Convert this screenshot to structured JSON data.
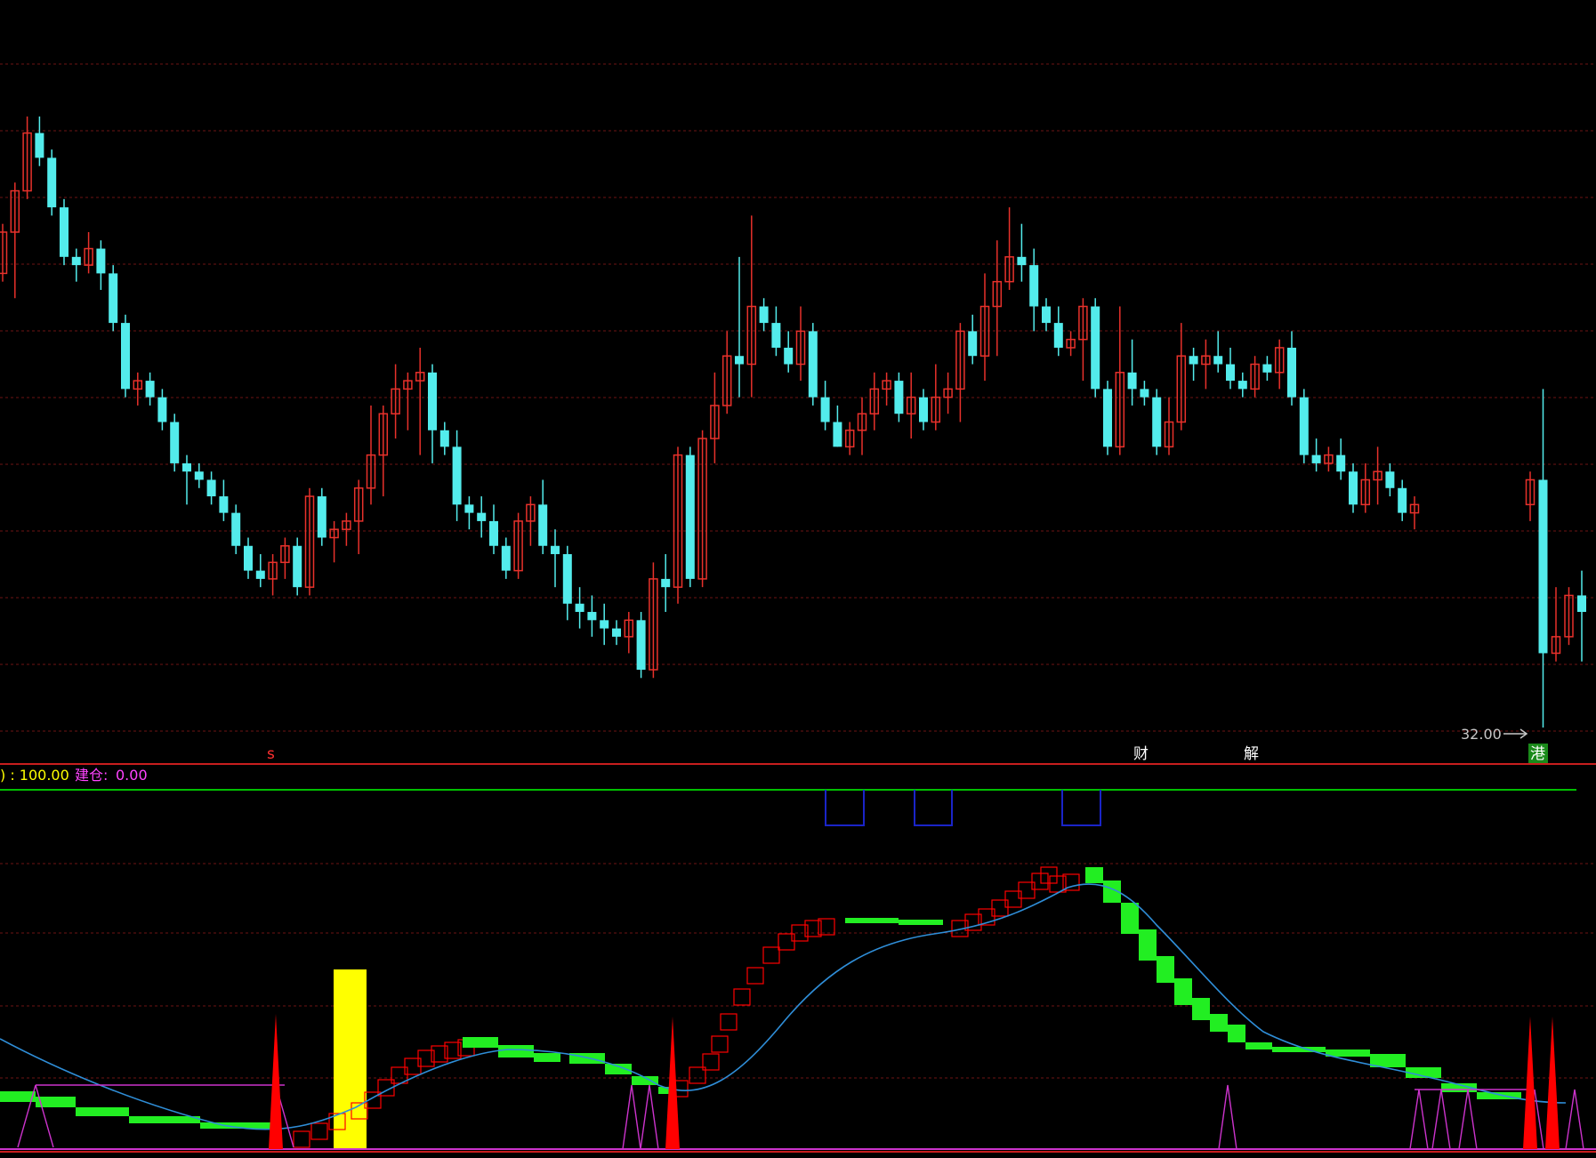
{
  "indicator_header": {
    "value_text": ") : 100.00",
    "label": "建仓:",
    "label_value": "0.00"
  },
  "markers": {
    "s": "s",
    "cai": "财",
    "jie": "解",
    "gang": "港"
  },
  "price_note": "32.00",
  "colors": {
    "up": "#e8312b",
    "down": "#53ecec",
    "grid": "#6e1414",
    "divider": "#c81e1e",
    "kline": "#00e000",
    "signal": "#ff0000",
    "blue_line": "#2f8ed8",
    "magenta": "#cc33cc",
    "yellow": "#ffff00",
    "box": "#1a24c8"
  },
  "chart_data": {
    "type": "candlestick",
    "ohlc": [
      [
        55,
        54,
        61,
        60
      ],
      [
        60,
        52,
        66,
        65
      ],
      [
        65,
        64,
        74,
        72
      ],
      [
        72,
        68,
        74,
        69
      ],
      [
        69,
        62,
        70,
        63
      ],
      [
        63,
        56,
        64,
        57
      ],
      [
        57,
        54,
        58,
        56
      ],
      [
        56,
        55,
        60,
        58
      ],
      [
        58,
        53,
        59,
        55
      ],
      [
        55,
        48,
        56,
        49
      ],
      [
        49,
        40,
        50,
        41
      ],
      [
        41,
        39,
        43,
        42
      ],
      [
        42,
        39,
        43,
        40
      ],
      [
        40,
        36,
        41,
        37
      ],
      [
        37,
        31,
        38,
        32
      ],
      [
        32,
        27,
        33,
        31
      ],
      [
        31,
        29,
        32,
        30
      ],
      [
        30,
        27,
        31,
        28
      ],
      [
        28,
        25,
        30,
        26
      ],
      [
        26,
        21,
        27,
        22
      ],
      [
        22,
        18,
        23,
        19
      ],
      [
        19,
        17,
        21,
        18
      ],
      [
        18,
        16,
        21,
        20
      ],
      [
        20,
        18,
        23,
        22
      ],
      [
        22,
        16,
        23,
        17
      ],
      [
        17,
        16,
        29,
        28
      ],
      [
        28,
        22,
        29,
        23
      ],
      [
        23,
        20,
        25,
        24
      ],
      [
        24,
        22,
        26,
        25
      ],
      [
        25,
        21,
        30,
        29
      ],
      [
        29,
        27,
        39,
        33
      ],
      [
        33,
        28,
        39,
        38
      ],
      [
        38,
        35,
        44,
        41
      ],
      [
        41,
        36,
        43,
        42
      ],
      [
        42,
        33,
        46,
        43
      ],
      [
        43,
        32,
        44,
        36
      ],
      [
        36,
        33,
        37,
        34
      ],
      [
        34,
        25,
        36,
        27
      ],
      [
        27,
        24,
        28,
        26
      ],
      [
        26,
        23,
        28,
        25
      ],
      [
        25,
        21,
        27,
        22
      ],
      [
        22,
        18,
        23,
        19
      ],
      [
        19,
        18,
        26,
        25
      ],
      [
        25,
        22,
        28,
        27
      ],
      [
        27,
        21,
        30,
        22
      ],
      [
        22,
        17,
        24,
        21
      ],
      [
        21,
        13,
        22,
        15
      ],
      [
        15,
        12,
        17,
        14
      ],
      [
        14,
        11,
        16,
        13
      ],
      [
        13,
        10,
        15,
        12
      ],
      [
        12,
        10,
        13,
        11
      ],
      [
        11,
        9,
        14,
        13
      ],
      [
        13,
        6,
        14,
        7
      ],
      [
        7,
        6,
        20,
        18
      ],
      [
        18,
        14,
        21,
        17
      ],
      [
        17,
        15,
        34,
        33
      ],
      [
        33,
        17,
        34,
        18
      ],
      [
        18,
        17,
        36,
        35
      ],
      [
        35,
        32,
        43,
        39
      ],
      [
        39,
        38,
        48,
        45
      ],
      [
        45,
        40,
        57,
        44
      ],
      [
        44,
        40,
        62,
        51
      ],
      [
        51,
        48,
        52,
        49
      ],
      [
        49,
        45,
        51,
        46
      ],
      [
        46,
        43,
        48,
        44
      ],
      [
        44,
        42,
        51,
        48
      ],
      [
        48,
        39,
        49,
        40
      ],
      [
        40,
        36,
        42,
        37
      ],
      [
        37,
        34,
        39,
        34
      ],
      [
        34,
        33,
        37,
        36
      ],
      [
        36,
        33,
        40,
        38
      ],
      [
        38,
        36,
        43,
        41
      ],
      [
        41,
        39,
        43,
        42
      ],
      [
        42,
        37,
        43,
        38
      ],
      [
        38,
        35,
        43,
        40
      ],
      [
        40,
        36,
        41,
        37
      ],
      [
        37,
        36,
        44,
        40
      ],
      [
        40,
        38,
        43,
        41
      ],
      [
        41,
        37,
        49,
        48
      ],
      [
        48,
        44,
        50,
        45
      ],
      [
        45,
        42,
        55,
        51
      ],
      [
        51,
        45,
        59,
        54
      ],
      [
        54,
        53,
        63,
        57
      ],
      [
        57,
        54,
        61,
        56
      ],
      [
        56,
        48,
        58,
        51
      ],
      [
        51,
        48,
        52,
        49
      ],
      [
        49,
        45,
        51,
        46
      ],
      [
        46,
        45,
        48,
        47
      ],
      [
        47,
        42,
        52,
        51
      ],
      [
        51,
        40,
        52,
        41
      ],
      [
        41,
        33,
        42,
        34
      ],
      [
        34,
        33,
        51,
        43
      ],
      [
        43,
        39,
        47,
        41
      ],
      [
        41,
        39,
        42,
        40
      ],
      [
        40,
        33,
        41,
        34
      ],
      [
        34,
        33,
        40,
        37
      ],
      [
        37,
        36,
        49,
        45
      ],
      [
        45,
        42,
        46,
        44
      ],
      [
        44,
        41,
        47,
        45
      ],
      [
        45,
        43,
        48,
        44
      ],
      [
        44,
        41,
        46,
        42
      ],
      [
        42,
        40,
        43,
        41
      ],
      [
        41,
        40,
        45,
        44
      ],
      [
        44,
        42,
        45,
        43
      ],
      [
        43,
        41,
        47,
        46
      ],
      [
        46,
        39,
        48,
        40
      ],
      [
        40,
        32,
        41,
        33
      ],
      [
        33,
        31,
        35,
        32
      ],
      [
        32,
        31,
        34,
        33
      ],
      [
        33,
        30,
        35,
        31
      ],
      [
        31,
        26,
        32,
        27
      ],
      [
        27,
        26,
        32,
        30
      ],
      [
        30,
        27,
        34,
        31
      ],
      [
        31,
        28,
        32,
        29
      ],
      [
        29,
        25,
        30,
        26
      ],
      [
        26,
        24,
        28,
        27
      ],
      [
        27,
        25,
        31,
        30
      ],
      [
        30,
        0,
        41,
        9
      ],
      [
        9,
        8,
        17,
        11
      ],
      [
        11,
        10,
        17,
        16
      ],
      [
        16,
        8,
        19,
        14
      ]
    ],
    "price_label": "32.00",
    "indicator": {
      "levels": [
        100,
        0
      ],
      "header_value": "100.00",
      "jiancang": "0.00"
    }
  }
}
